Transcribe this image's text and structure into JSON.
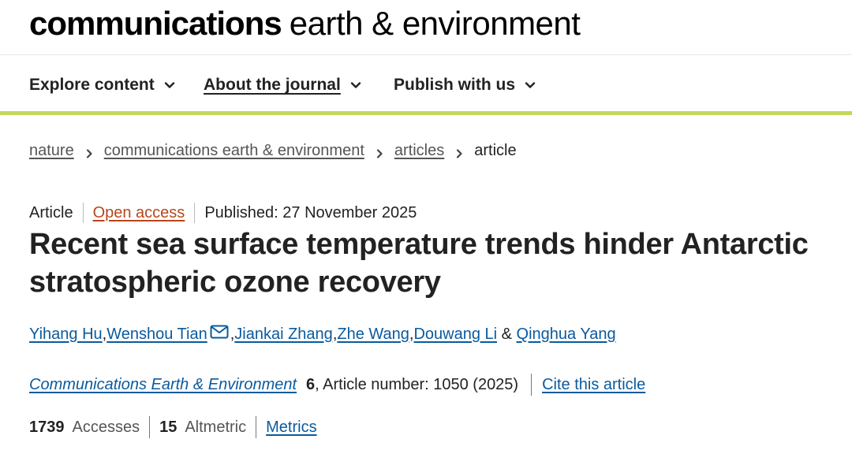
{
  "header": {
    "logo_bold": "communications",
    "logo_light": "earth & environment"
  },
  "nav": {
    "items": [
      {
        "label": "Explore content",
        "icon": "chevron-down-icon"
      },
      {
        "label": "About the journal",
        "icon": "chevron-down-icon"
      },
      {
        "label": "Publish with us",
        "icon": "chevron-down-icon"
      }
    ],
    "accent_color": "#c3d85a"
  },
  "breadcrumb": {
    "items": [
      "nature",
      "communications earth & environment",
      "articles"
    ],
    "current": "article",
    "separator_icon": "chevron-right-icon"
  },
  "article": {
    "type": "Article",
    "access": "Open access",
    "published": "Published: 27 November 2025",
    "title": "Recent sea surface temperature trends hinder Antarctic stratospheric ozone recovery",
    "authors": [
      "Yihang Hu",
      "Wenshou Tian",
      "Jiankai Zhang",
      "Zhe Wang",
      "Douwang Li",
      "Qinghua Yang"
    ],
    "author_sep": ", ",
    "author_and": " & ",
    "corresponding_icon": "mail-icon",
    "journal": "Communications Earth & Environment",
    "volume": "6",
    "article_number": ", Article number: 1050 (2025)",
    "cite_label": "Cite this article",
    "accesses_count": "1739",
    "accesses_label": "Accesses",
    "altmetric_count": "15",
    "altmetric_label": "Altmetric",
    "metrics_label": "Metrics"
  },
  "colors": {
    "link": "#0a5a9e",
    "open_access": "#b8461b"
  }
}
